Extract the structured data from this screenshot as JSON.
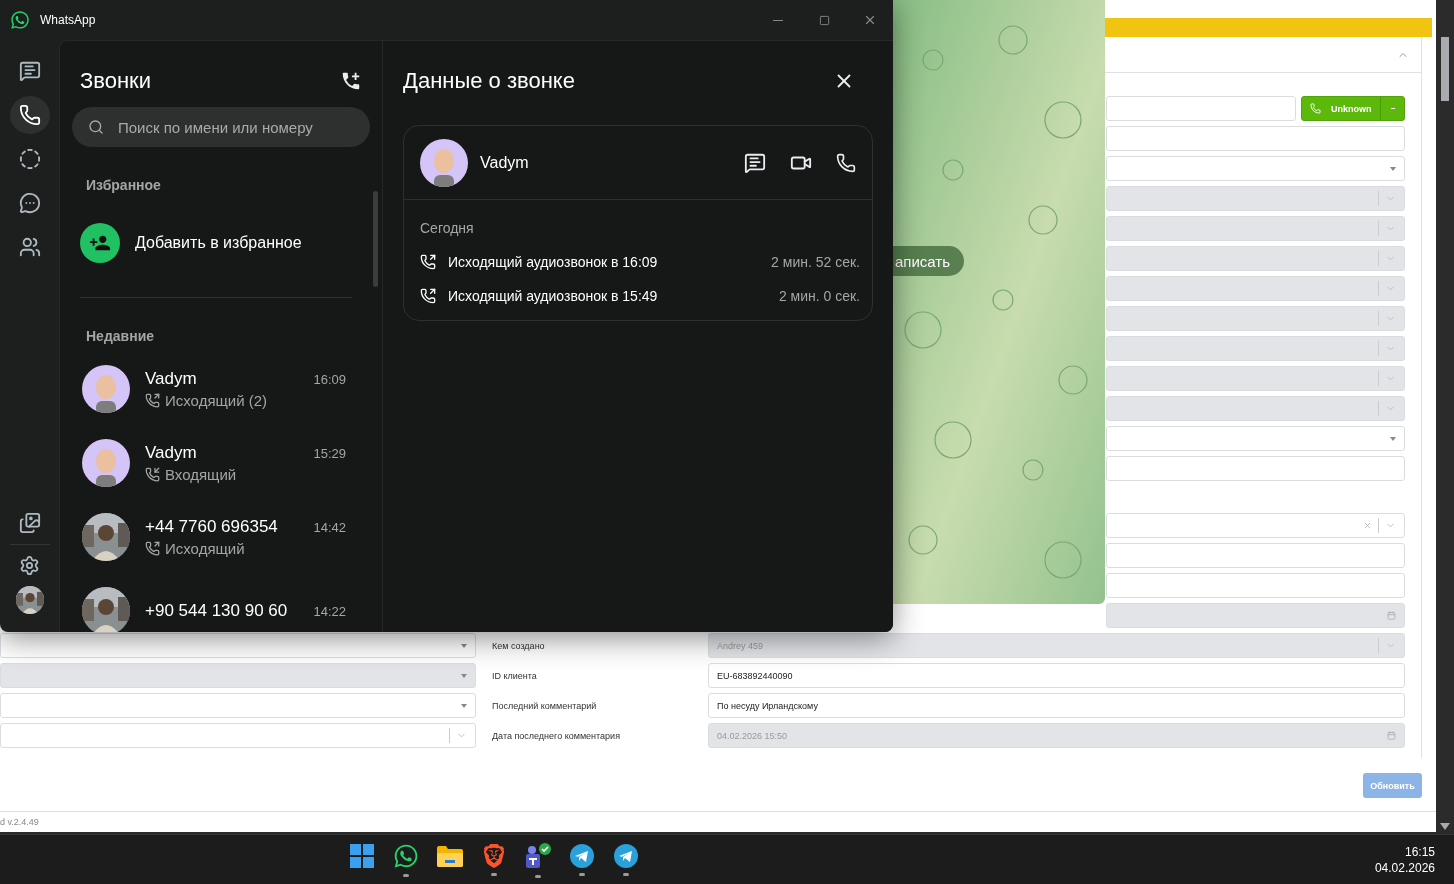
{
  "whatsapp": {
    "title": "WhatsApp",
    "rail": [
      {
        "kind": "chats",
        "selected": false
      },
      {
        "kind": "calls",
        "selected": true
      },
      {
        "kind": "status",
        "selected": false
      },
      {
        "kind": "channels",
        "selected": false
      },
      {
        "kind": "communities",
        "selected": false
      }
    ],
    "rail_bottom": [
      {
        "kind": "media"
      },
      {
        "kind": "settings"
      },
      {
        "kind": "profile"
      }
    ],
    "calls": {
      "title": "Звонки",
      "search": {
        "placeholder": "Поиск по имени или номеру"
      },
      "favorites_heading": "Избранное",
      "add_favorite": "Добавить в избранное",
      "recent_heading": "Недавние",
      "items": [
        {
          "name": "Vadym",
          "kind": "outgoing",
          "detail": "Исходящий (2)",
          "time": "16:09",
          "avatar": {
            "kind": "cartoon"
          }
        },
        {
          "name": "Vadym",
          "kind": "incoming",
          "detail": "Входящий",
          "time": "15:29",
          "avatar": {
            "kind": "cartoon"
          }
        },
        {
          "name": "+44 7760 696354",
          "kind": "outgoing",
          "detail": "Исходящий",
          "time": "14:42"
        },
        {
          "name": "+90 544 130 90 60",
          "time": "14:22"
        }
      ]
    },
    "details": {
      "title": "Данные о звонке",
      "contact": "Vadym",
      "day": "Сегодня",
      "calls": [
        {
          "kind": "outgoing",
          "label": "Исходящий аудиозвонок в 16:09",
          "duration": "2 мин. 52 сек."
        },
        {
          "kind": "outgoing",
          "label": "Исходящий аудиозвонок в 15:49",
          "duration": "2 мин. 0 сек."
        }
      ]
    }
  },
  "telegram": {
    "button": "аписать"
  },
  "crm": {
    "call_button": {
      "label": "Unknown"
    },
    "field_groups": [
      [
        {
          "kind": "phone",
          "disabled": false
        },
        {
          "kind": "text",
          "disabled": false
        },
        {
          "kind": "select",
          "disabled": false
        },
        {
          "kind": "chevron",
          "disabled": true
        },
        {
          "kind": "chevron",
          "disabled": true
        },
        {
          "kind": "chevron",
          "disabled": true
        },
        {
          "kind": "chevron",
          "disabled": true
        },
        {
          "kind": "chevron",
          "disabled": true
        },
        {
          "kind": "chevron",
          "disabled": true
        },
        {
          "kind": "chevron",
          "disabled": true
        },
        {
          "kind": "chevron",
          "disabled": true
        },
        {
          "kind": "select",
          "disabled": false
        },
        {
          "kind": "text",
          "disabled": false
        }
      ],
      [
        {
          "kind": "clearable",
          "disabled": false
        },
        {
          "kind": "text",
          "disabled": false
        },
        {
          "kind": "text",
          "disabled": false
        },
        {
          "kind": "date",
          "disabled": true
        },
        {
          "kind": "chevron",
          "disabled": true,
          "label": "Кем создано",
          "value": "Andrey 459"
        },
        {
          "kind": "text",
          "disabled": false,
          "label": "ID клиента",
          "value": "EU-683892440090"
        },
        {
          "kind": "text",
          "disabled": false,
          "label": "Последний комментарий",
          "value": "По несуду Ирландскому"
        },
        {
          "kind": "date",
          "disabled": true,
          "label": "Дата последнего комментария",
          "value": "04.02.2026 15:50"
        }
      ]
    ],
    "left_fields": [
      {
        "kind": "select",
        "disabled": false
      },
      {
        "kind": "select",
        "disabled": true
      },
      {
        "kind": "select",
        "disabled": false
      },
      {
        "kind": "chevron",
        "disabled": false
      }
    ],
    "update_button": "Обновить",
    "version": "d v.2.4.49"
  },
  "taskbar": {
    "apps": [
      {
        "kind": "start",
        "running": false
      },
      {
        "kind": "whatsapp",
        "running": true
      },
      {
        "kind": "files",
        "running": false
      },
      {
        "kind": "browser",
        "running": true
      },
      {
        "kind": "teams",
        "running": true
      },
      {
        "kind": "telegram",
        "running": true
      },
      {
        "kind": "telegram",
        "running": true
      }
    ],
    "time": "16:15",
    "date": "04.02.2026"
  }
}
